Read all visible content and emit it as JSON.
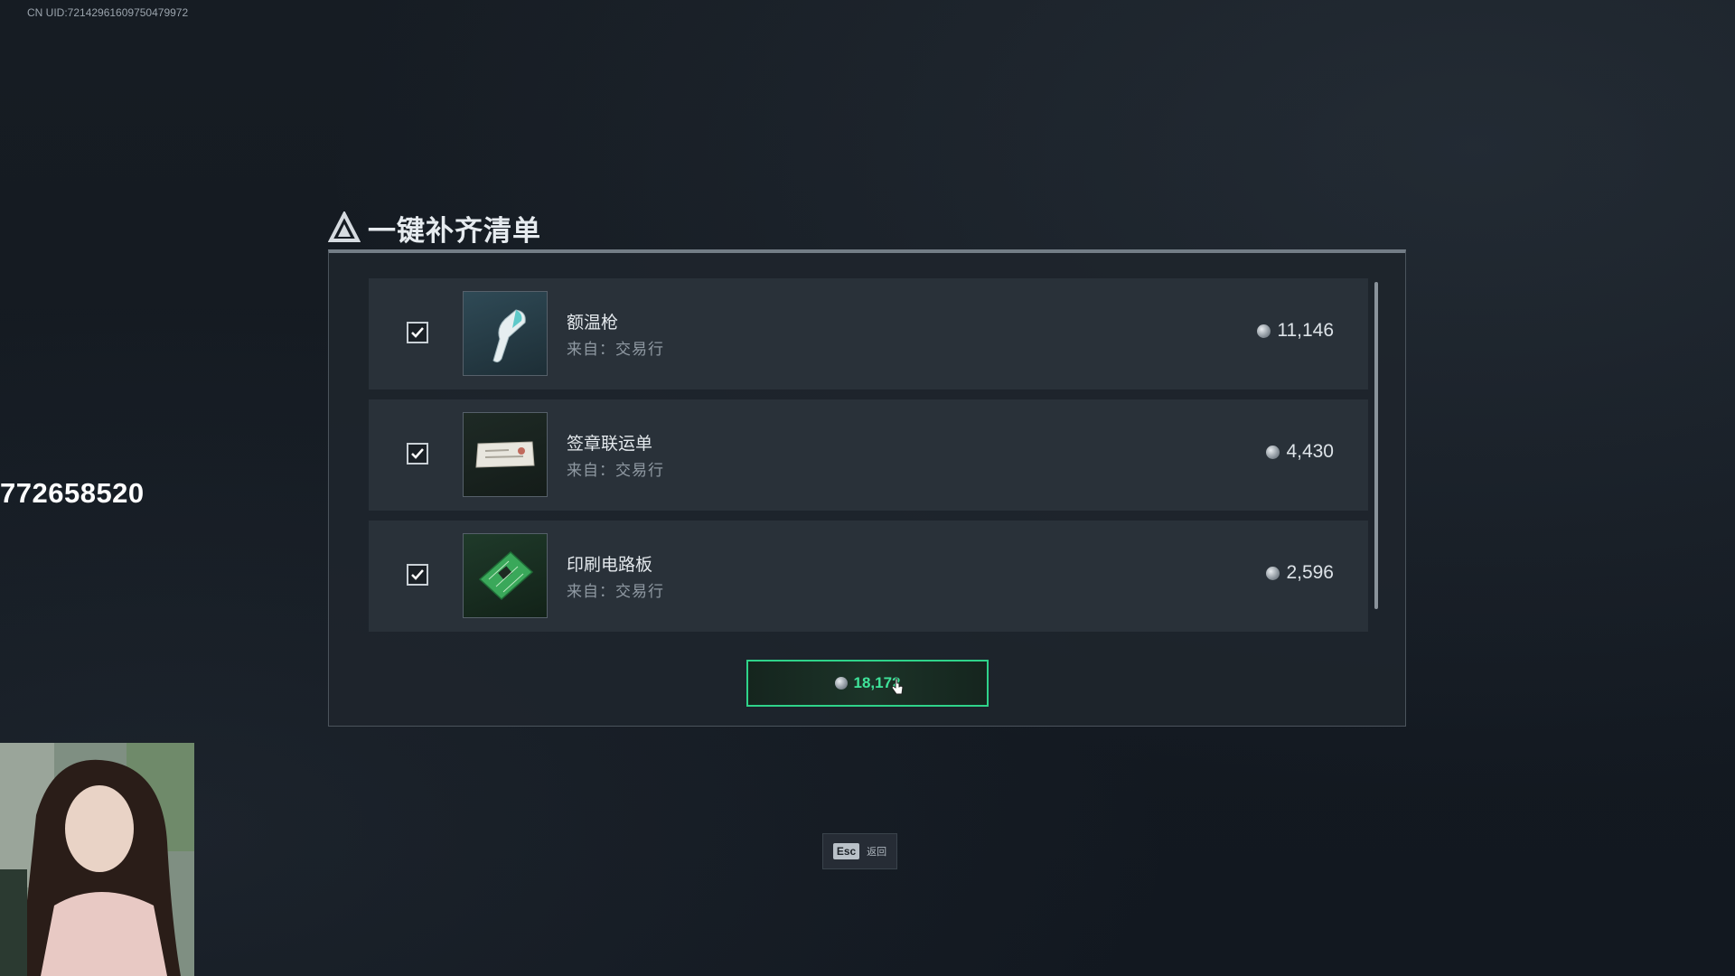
{
  "overlay": {
    "uid": "CN UID:7214296160975047997​2",
    "number": "772658520"
  },
  "dialog": {
    "title": "一键补齐清单",
    "items": [
      {
        "name": "额温枪",
        "source": "来自：交易行",
        "price": "11,146",
        "checked": true,
        "icon": "thermometer-gun-icon"
      },
      {
        "name": "签章联运单",
        "source": "来自：交易行",
        "price": "4,430",
        "checked": true,
        "icon": "document-icon"
      },
      {
        "name": "印刷电路板",
        "source": "来自：交易行",
        "price": "2,596",
        "checked": true,
        "icon": "circuit-board-icon"
      }
    ],
    "confirm_amount": "18,172"
  },
  "footer": {
    "esc_key": "Esc",
    "esc_label": "返回"
  },
  "colors": {
    "accent": "#2fd38a",
    "background": "#141a21",
    "panel": "#1e252c"
  }
}
